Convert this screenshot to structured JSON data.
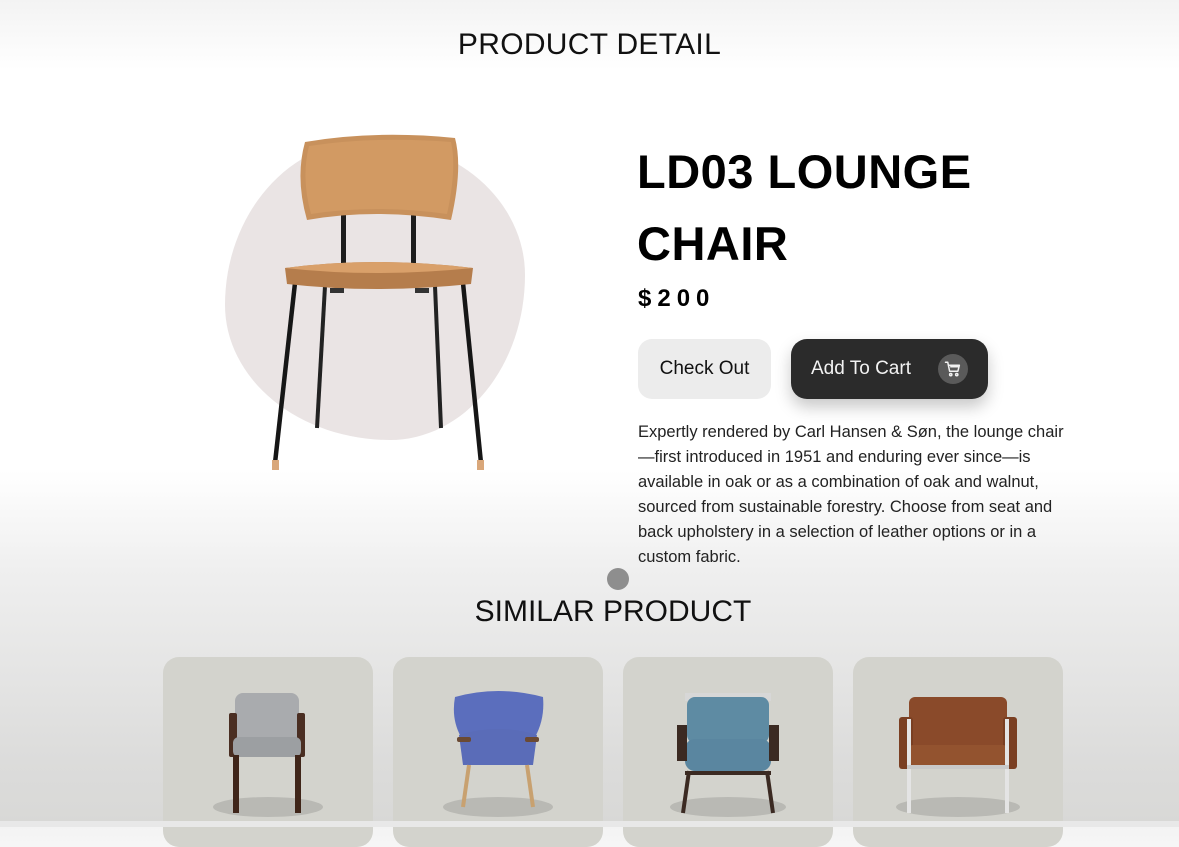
{
  "page": {
    "heading": "PRODUCT DETAIL"
  },
  "product": {
    "title": "LD03 LOUNGE CHAIR",
    "price": "$200",
    "description": "Expertly rendered by Carl Hansen & Søn, the lounge chair—first introduced in 1951 and enduring ever since—is available in oak or as a combination of oak and walnut, sourced from sustainable forestry. Choose from seat and back upholstery in a selection of leather options or in a custom fabric.",
    "image_icon": "wooden-chair-image"
  },
  "actions": {
    "checkout_label": "Check Out",
    "add_to_cart_label": "Add To Cart",
    "cart_icon": "cart-icon"
  },
  "similar": {
    "heading": "SIMILAR PRODUCT",
    "items": [
      {
        "icon": "grey-armchair-image",
        "color": "#9c9fa2"
      },
      {
        "icon": "blue-wingback-chair-image",
        "color": "#5b6ebd"
      },
      {
        "icon": "teal-lounge-chair-image",
        "color": "#5e8ba3"
      },
      {
        "icon": "brown-leather-armchair-image",
        "color": "#8a4a2a"
      }
    ]
  },
  "colors": {
    "primary_button": "#2b2b2b",
    "secondary_button": "#ececec",
    "image_blob": "#eae4e4",
    "card_bg": "#d3d3cd"
  }
}
